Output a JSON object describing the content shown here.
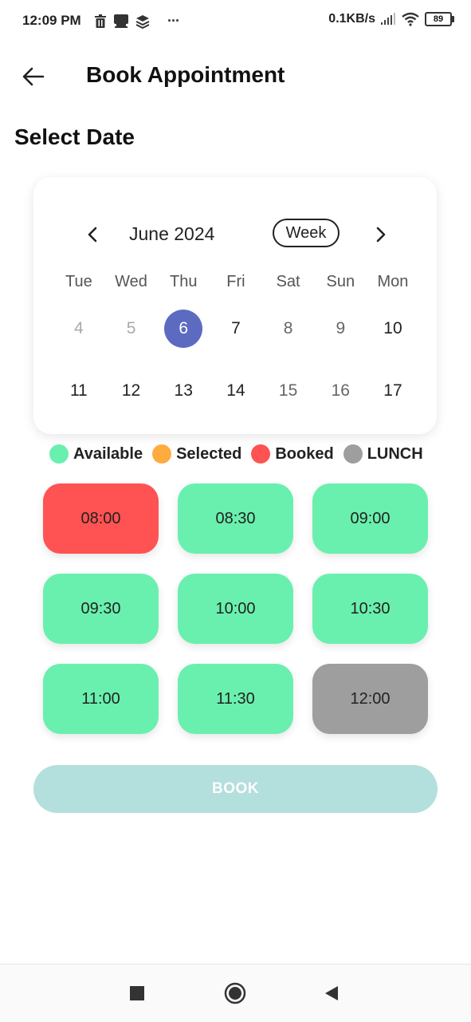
{
  "status_bar": {
    "time": "12:09 PM",
    "more": "···",
    "net_speed": "0.1KB/s",
    "battery": "89",
    "icons": [
      "trash-icon",
      "notification-icon",
      "layers-icon",
      "signal-icon",
      "wifi-icon",
      "battery-icon"
    ]
  },
  "app_bar": {
    "title": "Book Appointment",
    "back_icon": "arrow-left-icon"
  },
  "section_title": "Select Date",
  "calendar": {
    "month_label": "June 2024",
    "format_toggle": "Week",
    "weekdays": [
      "Tue",
      "Wed",
      "Thu",
      "Fri",
      "Sat",
      "Sun",
      "Mon"
    ],
    "week1": [
      "4",
      "5",
      "6",
      "7",
      "8",
      "9",
      "10"
    ],
    "week2": [
      "11",
      "12",
      "13",
      "14",
      "15",
      "16",
      "17"
    ],
    "selected_day": "6",
    "selected_color": "#5c6bc0"
  },
  "legend": [
    {
      "label": "Available",
      "color": "#69f0ae"
    },
    {
      "label": "Selected",
      "color": "#ffab40"
    },
    {
      "label": "Booked",
      "color": "#ff5252"
    },
    {
      "label": "LUNCH",
      "color": "#9e9e9e"
    }
  ],
  "slots": [
    {
      "time": "08:00",
      "status": "booked",
      "color": "#ff5252"
    },
    {
      "time": "08:30",
      "status": "available",
      "color": "#69f0ae"
    },
    {
      "time": "09:00",
      "status": "available",
      "color": "#69f0ae"
    },
    {
      "time": "09:30",
      "status": "available",
      "color": "#69f0ae"
    },
    {
      "time": "10:00",
      "status": "available",
      "color": "#69f0ae"
    },
    {
      "time": "10:30",
      "status": "available",
      "color": "#69f0ae"
    },
    {
      "time": "11:00",
      "status": "available",
      "color": "#69f0ae"
    },
    {
      "time": "11:30",
      "status": "available",
      "color": "#69f0ae"
    },
    {
      "time": "12:00",
      "status": "lunch",
      "color": "#9e9e9e"
    }
  ],
  "book_button": {
    "label": "BOOK",
    "color": "#b3dfdc"
  },
  "nav_bar": {
    "icons": [
      "recents-square-icon",
      "home-circle-icon",
      "back-triangle-icon"
    ]
  }
}
